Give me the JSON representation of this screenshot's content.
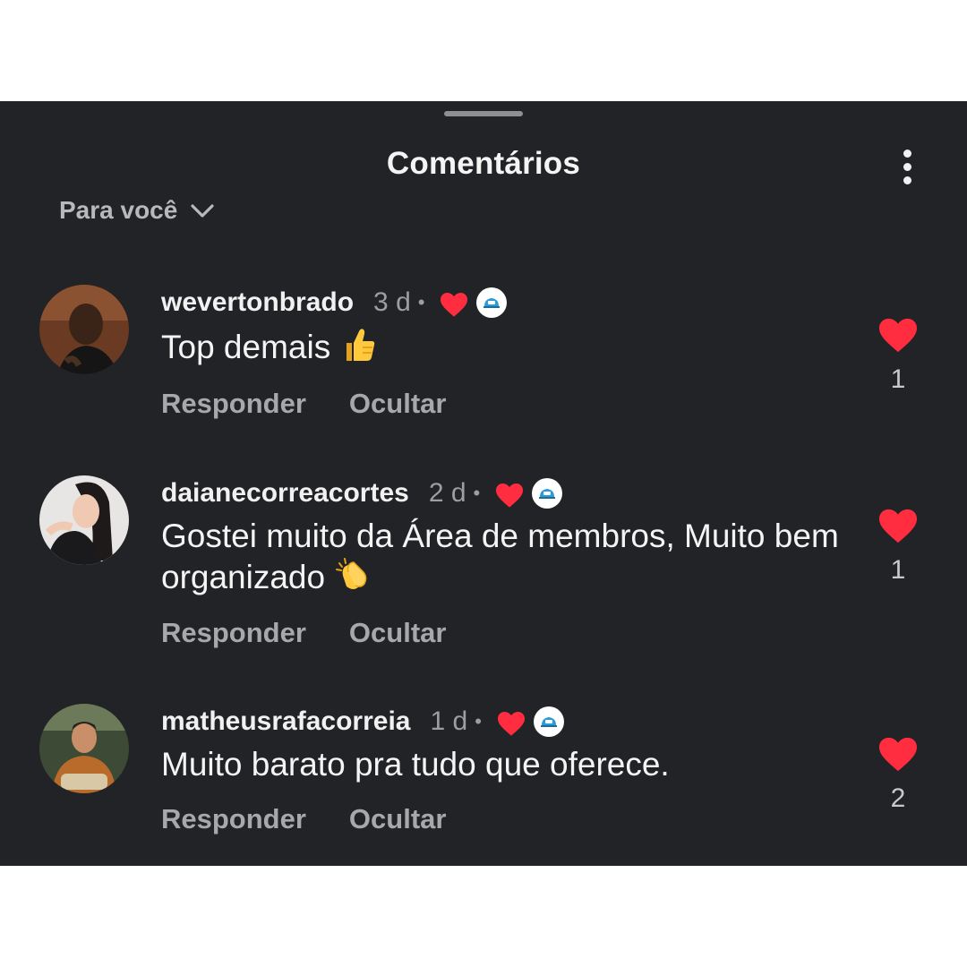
{
  "sheet": {
    "title": "Comentários",
    "more_icon": "vertical-ellipsis-icon",
    "sort_label": "Para você",
    "sort_icon": "chevron-down-icon"
  },
  "colors": {
    "background": "#222326",
    "heart": "#ff2d3f",
    "text_primary": "#f4f4f5",
    "text_secondary": "#9d9ea2"
  },
  "comments": [
    {
      "username": "wevertonbrado",
      "time": "3 d",
      "separator": "•",
      "text": "Top demais",
      "emoji": "thumbs-up",
      "reply_label": "Responder",
      "hide_label": "Ocultar",
      "likes": "1",
      "liked_by_creator": true
    },
    {
      "username": "daianecorreacortes",
      "time": "2 d",
      "separator": "•",
      "text": "Gostei muito da Área de membros, Muito bem organizado",
      "emoji": "clapping-hands",
      "reply_label": "Responder",
      "hide_label": "Ocultar",
      "likes": "1",
      "liked_by_creator": true
    },
    {
      "username": "matheusrafacorreia",
      "time": "1 d",
      "separator": "•",
      "text": "Muito barato pra tudo que oferece.",
      "emoji": "",
      "reply_label": "Responder",
      "hide_label": "Ocultar",
      "likes": "2",
      "liked_by_creator": true
    }
  ]
}
